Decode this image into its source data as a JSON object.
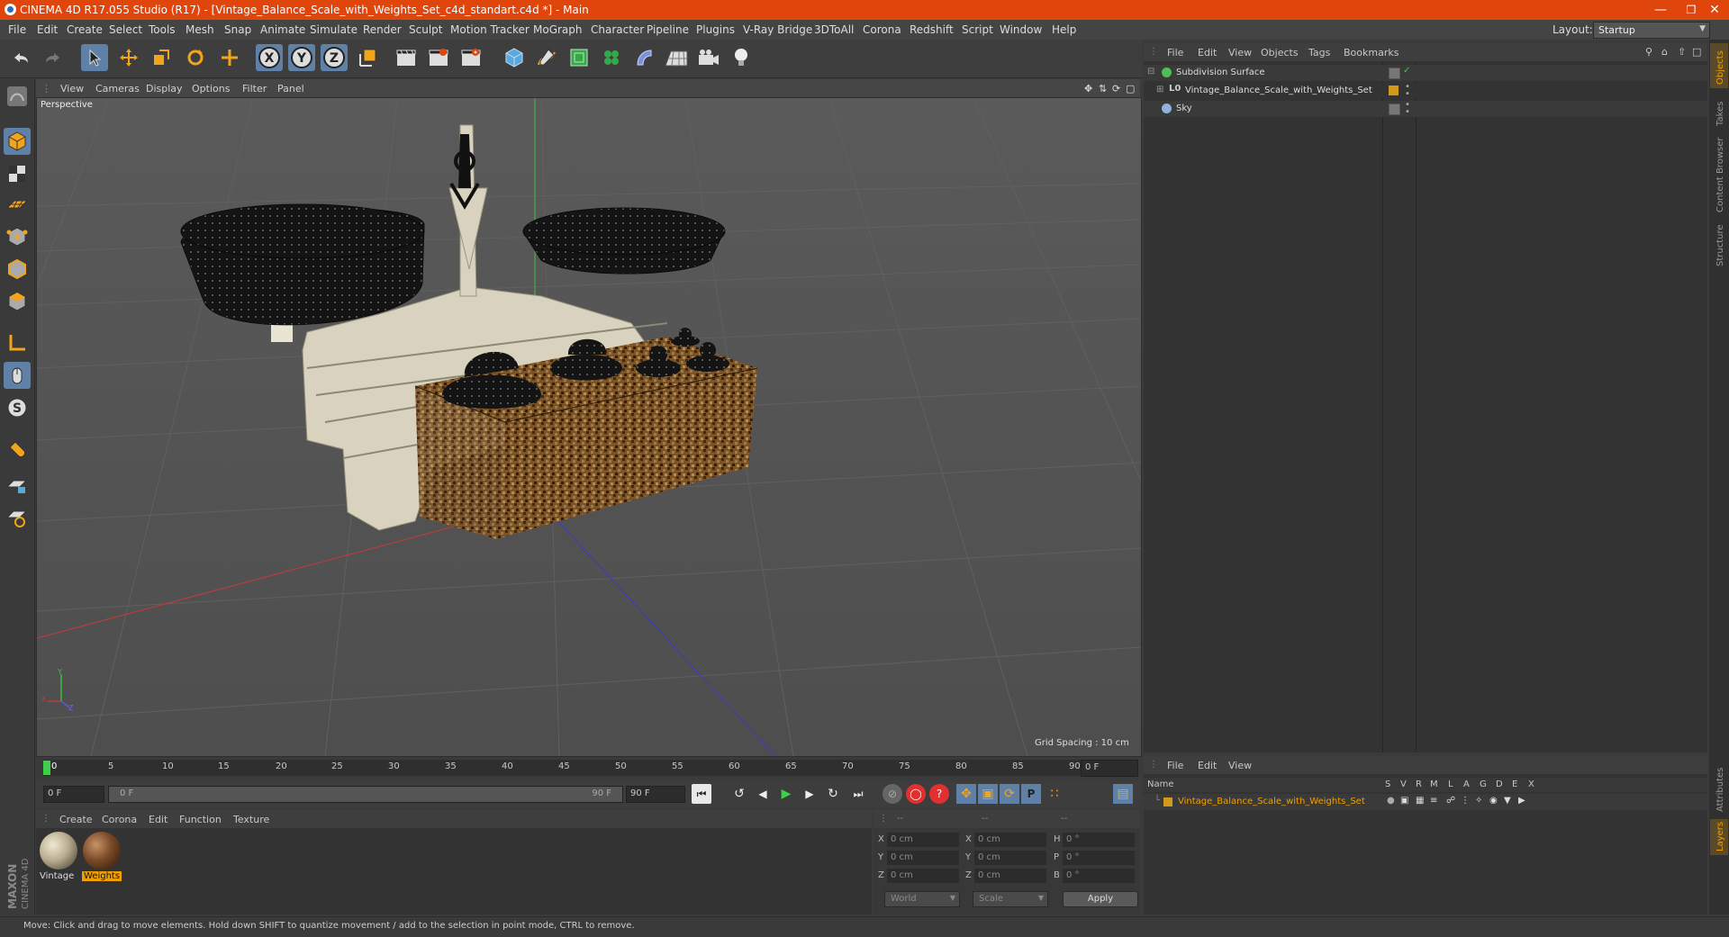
{
  "window": {
    "title": "CINEMA 4D R17.055 Studio (R17) - [Vintage_Balance_Scale_with_Weights_Set_c4d_standart.c4d *] - Main",
    "controls": [
      "minimize",
      "restore",
      "close"
    ]
  },
  "menubar": {
    "items": [
      "File",
      "Edit",
      "Create",
      "Select",
      "Tools",
      "Mesh",
      "Snap",
      "Animate",
      "Simulate",
      "Render",
      "Sculpt",
      "Motion Tracker",
      "MoGraph",
      "Character",
      "Pipeline",
      "Plugins",
      "V-Ray Bridge",
      "3DToAll",
      "Corona",
      "Redshift",
      "Script",
      "Window",
      "Help"
    ],
    "layout_label": "Layout:",
    "layout_value": "Startup"
  },
  "viewport": {
    "menu": [
      "View",
      "Cameras",
      "Display",
      "Options",
      "Filter",
      "Panel"
    ],
    "camera_label": "Perspective",
    "grid_spacing": "Grid Spacing : 10 cm",
    "axis_labels": {
      "y": "Y",
      "x": "X",
      "z": "Z"
    }
  },
  "timeline": {
    "ticks": [
      "0",
      "5",
      "10",
      "15",
      "20",
      "25",
      "30",
      "35",
      "40",
      "45",
      "50",
      "55",
      "60",
      "65",
      "70",
      "75",
      "80",
      "85",
      "90"
    ],
    "current_frame": "0 F",
    "start_frame": "0 F",
    "range_start": "0 F",
    "range_end": "90 F",
    "end_frame": "90 F"
  },
  "material_manager": {
    "menu": [
      "Create",
      "Corona",
      "Edit",
      "Function",
      "Texture"
    ],
    "materials": [
      {
        "name": "Vintage",
        "selected": false,
        "color": "#b9ad8f"
      },
      {
        "name": "Weights",
        "selected": true,
        "color": "#7a4a28"
      }
    ]
  },
  "coordinates": {
    "headers": [
      "--",
      "--",
      "--"
    ],
    "rows": [
      {
        "a_label": "X",
        "a_val": "0 cm",
        "b_label": "X",
        "b_val": "0 cm",
        "c_label": "H",
        "c_val": "0 °"
      },
      {
        "a_label": "Y",
        "a_val": "0 cm",
        "b_label": "Y",
        "b_val": "0 cm",
        "c_label": "P",
        "c_val": "0 °"
      },
      {
        "a_label": "Z",
        "a_val": "0 cm",
        "b_label": "Z",
        "b_val": "0 cm",
        "c_label": "B",
        "c_val": "0 °"
      }
    ],
    "world_select": "World",
    "scale_select": "Scale",
    "apply_label": "Apply"
  },
  "object_manager": {
    "menu": [
      "File",
      "Edit",
      "View",
      "Objects",
      "Tags",
      "Bookmarks"
    ],
    "objects": [
      {
        "name": "Subdivision Surface",
        "icon": "subdivision-icon",
        "color": "#4fbf5a"
      },
      {
        "name": "Vintage_Balance_Scale_with_Weights_Set",
        "icon": "null-object-icon",
        "color": "#d29a1d"
      },
      {
        "name": "Sky",
        "icon": "sky-icon",
        "color": "#8fb3d9"
      }
    ]
  },
  "layer_manager": {
    "menu": [
      "File",
      "Edit",
      "View"
    ],
    "columns": [
      "Name",
      "S",
      "V",
      "R",
      "M",
      "L",
      "A",
      "G",
      "D",
      "E",
      "X"
    ],
    "layers": [
      {
        "name": "Vintage_Balance_Scale_with_Weights_Set",
        "color": "#d29a1d"
      }
    ]
  },
  "right_tabs": [
    "Objects",
    "Takes",
    "Content Browser",
    "Structure"
  ],
  "right_tabs_lower": [
    "Attributes",
    "Layers"
  ],
  "branding": "MAXON CINEMA 4D",
  "status": "Move: Click and drag to move elements. Hold down SHIFT to quantize movement / add to the selection in point mode, CTRL to remove.",
  "colors": {
    "accent": "#e0460c",
    "selection": "#5f81a8",
    "orange_label": "#f0a000"
  }
}
